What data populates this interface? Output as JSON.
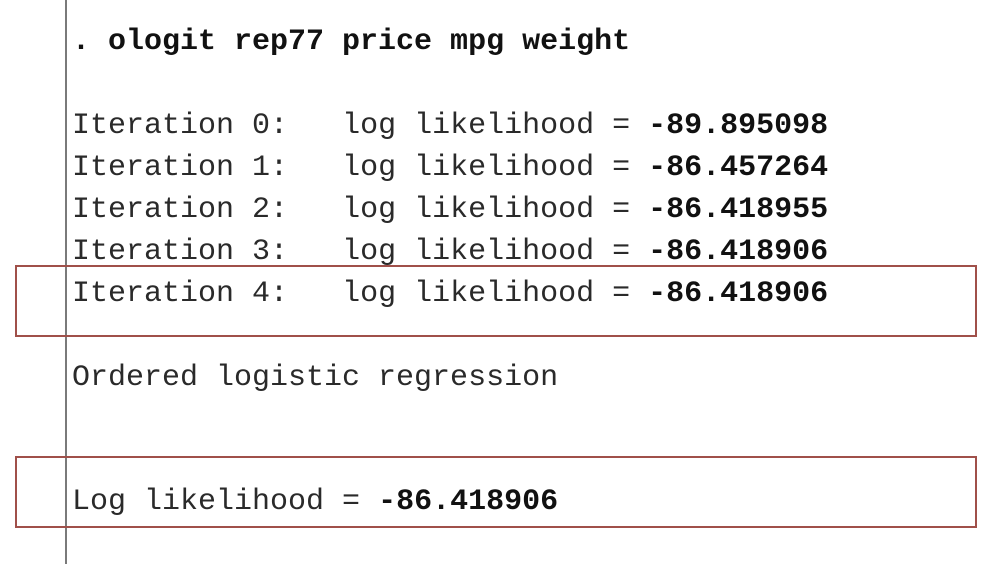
{
  "command": ". ologit rep77 price mpg weight",
  "iterations": [
    {
      "label": "Iteration 0:",
      "text": "log likelihood = ",
      "value": "-89.895098"
    },
    {
      "label": "Iteration 1:",
      "text": "log likelihood = ",
      "value": "-86.457264"
    },
    {
      "label": "Iteration 2:",
      "text": "log likelihood = ",
      "value": "-86.418955"
    },
    {
      "label": "Iteration 3:",
      "text": "log likelihood = ",
      "value": "-86.418906"
    },
    {
      "label": "Iteration 4:",
      "text": "log likelihood = ",
      "value": "-86.418906"
    }
  ],
  "model_title": "Ordered logistic regression",
  "final": {
    "text": "Log likelihood = ",
    "value": "-86.418906"
  },
  "colors": {
    "highlight_border": "#a0504a",
    "divider": "#7a7a7a"
  }
}
